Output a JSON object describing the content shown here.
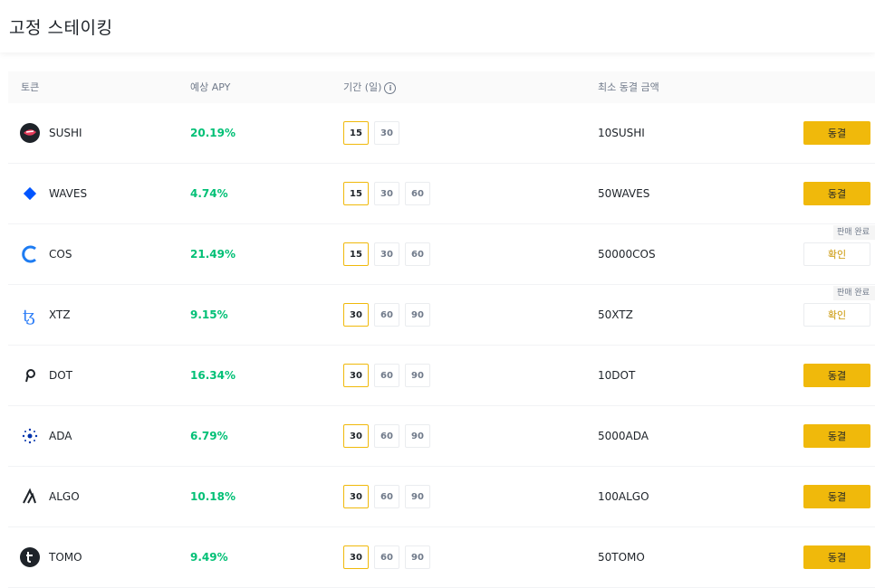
{
  "page": {
    "title": "고정 스테이킹"
  },
  "table": {
    "headers": {
      "token": "토큰",
      "apy": "예상 APY",
      "duration": "기간 (일)",
      "min_amount": "최소 동결 금액"
    },
    "rows": [
      {
        "token": "SUSHI",
        "icon": "sushi-icon",
        "apy": "20.19%",
        "durations": [
          "15",
          "30"
        ],
        "selected": 0,
        "min": "10SUSHI",
        "action": "동결",
        "action_type": "stake",
        "badge": ""
      },
      {
        "token": "WAVES",
        "icon": "waves-icon",
        "apy": "4.74%",
        "durations": [
          "15",
          "30",
          "60"
        ],
        "selected": 0,
        "min": "50WAVES",
        "action": "동결",
        "action_type": "stake",
        "badge": ""
      },
      {
        "token": "COS",
        "icon": "cos-icon",
        "apy": "21.49%",
        "durations": [
          "15",
          "30",
          "60"
        ],
        "selected": 0,
        "min": "50000COS",
        "action": "확인",
        "action_type": "confirm",
        "badge": "판매 완료"
      },
      {
        "token": "XTZ",
        "icon": "xtz-icon",
        "apy": "9.15%",
        "durations": [
          "30",
          "60",
          "90"
        ],
        "selected": 0,
        "min": "50XTZ",
        "action": "확인",
        "action_type": "confirm",
        "badge": "판매 완료"
      },
      {
        "token": "DOT",
        "icon": "dot-icon",
        "apy": "16.34%",
        "durations": [
          "30",
          "60",
          "90"
        ],
        "selected": 0,
        "min": "10DOT",
        "action": "동결",
        "action_type": "stake",
        "badge": ""
      },
      {
        "token": "ADA",
        "icon": "ada-icon",
        "apy": "6.79%",
        "durations": [
          "30",
          "60",
          "90"
        ],
        "selected": 0,
        "min": "5000ADA",
        "action": "동결",
        "action_type": "stake",
        "badge": ""
      },
      {
        "token": "ALGO",
        "icon": "algo-icon",
        "apy": "10.18%",
        "durations": [
          "30",
          "60",
          "90"
        ],
        "selected": 0,
        "min": "100ALGO",
        "action": "동결",
        "action_type": "stake",
        "badge": ""
      },
      {
        "token": "TOMO",
        "icon": "tomo-icon",
        "apy": "9.49%",
        "durations": [
          "30",
          "60",
          "90"
        ],
        "selected": 0,
        "min": "50TOMO",
        "action": "동결",
        "action_type": "stake",
        "badge": ""
      }
    ]
  },
  "colors": {
    "accent": "#f0b90b",
    "positive": "#02c076",
    "text": "#1e2329",
    "muted": "#707a8a"
  }
}
